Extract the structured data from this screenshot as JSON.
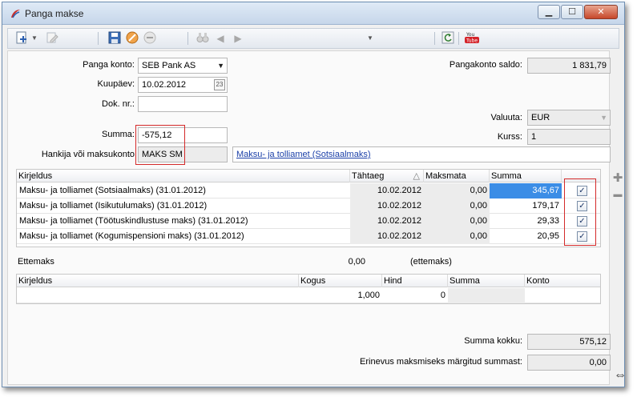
{
  "window": {
    "title": "Panga makse",
    "minimize": "▁",
    "maximize": "☐",
    "close": "✕"
  },
  "toolbar": {
    "icons": [
      "add-icon",
      "dropdown-arrow-icon",
      "edit-icon",
      "save-icon",
      "cancel-icon",
      "remove-icon",
      "binoculars-icon",
      "prev-icon",
      "next-icon",
      "dropdown-arrow-icon",
      "refresh-icon",
      "youtube-icon"
    ]
  },
  "form": {
    "bank_account_label": "Panga konto:",
    "bank_account_value": "SEB Pank AS",
    "date_label": "Kuupäev:",
    "date_value": "10.02.2012",
    "calendar_day": "23",
    "doc_nr_label": "Dok. nr.:",
    "doc_nr_value": "",
    "sum_label": "Summa:",
    "sum_value": "-575,12",
    "supplier_label": "Hankija või maksukonto",
    "supplier_value": "MAKS SM",
    "supplier_link": "Maksu- ja tolliamet (Sotsiaalmaks)",
    "balance_label": "Pangakonto saldo:",
    "balance_value": "1 831,79",
    "currency_label": "Valuuta:",
    "currency_value": "EUR",
    "rate_label": "Kurss:",
    "rate_value": "1"
  },
  "invoice_grid": {
    "headers": {
      "description": "Kirjeldus",
      "due_date": "Tähtaeg",
      "sort_icon": "△",
      "unpaid": "Maksmata",
      "sum": "Summa"
    },
    "rows": [
      {
        "description": "Maksu- ja tolliamet (Sotsiaalmaks) (31.01.2012)",
        "due_date": "10.02.2012",
        "unpaid": "0,00",
        "sum": "345,67",
        "checked": "✓"
      },
      {
        "description": "Maksu- ja tolliamet (Isikutulumaks) (31.01.2012)",
        "due_date": "10.02.2012",
        "unpaid": "0,00",
        "sum": "179,17",
        "checked": "✓"
      },
      {
        "description": "Maksu- ja tolliamet (Töötuskindlustuse maks) (31.01.2012)",
        "due_date": "10.02.2012",
        "unpaid": "0,00",
        "sum": "29,33",
        "checked": "✓"
      },
      {
        "description": "Maksu- ja tolliamet (Kogumispensioni maks) (31.01.2012)",
        "due_date": "10.02.2012",
        "unpaid": "0,00",
        "sum": "20,95",
        "checked": "✓"
      }
    ],
    "add_icon": "✚",
    "remove_icon": "▬"
  },
  "prepayment": {
    "label": "Ettemaks",
    "value": "0,00",
    "note": "(ettemaks)"
  },
  "items_grid": {
    "headers": {
      "description": "Kirjeldus",
      "quantity": "Kogus",
      "price": "Hind",
      "sum": "Summa",
      "account": "Konto"
    },
    "rows": [
      {
        "description": "",
        "quantity": "1,000",
        "price": "0",
        "sum": "",
        "account": ""
      }
    ]
  },
  "totals": {
    "total_label": "Summa kokku:",
    "total_value": "575,12",
    "diff_label": "Erinevus maksmiseks märgitud summast:",
    "diff_value": "0,00"
  }
}
